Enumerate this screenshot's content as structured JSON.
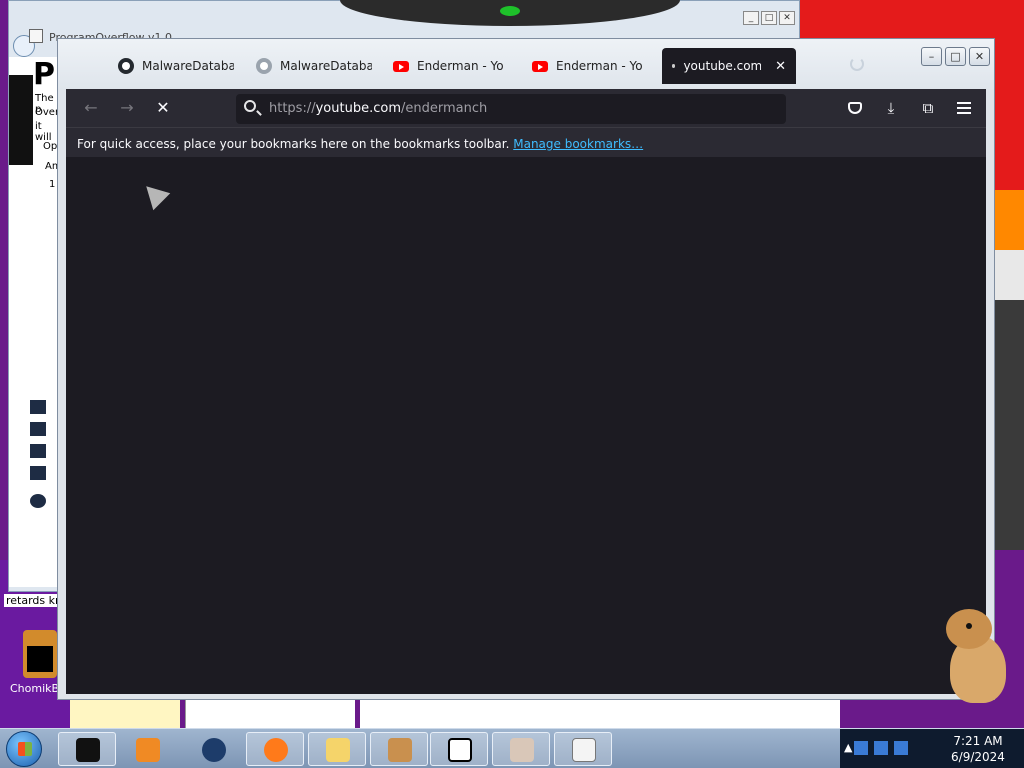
{
  "background_window": {
    "title": "ProgramOverflow v1.0",
    "heading_initial": "Pr",
    "text_lines": [
      "The p",
      "Over",
      "it will"
    ],
    "group_label": "Op",
    "field_label": "Am",
    "field_value": "1"
  },
  "desktop": {
    "text_strip": "retards kn",
    "icon_label": "ChomikB"
  },
  "browser": {
    "tabs": [
      {
        "label": "MalwareDatabase",
        "icon": "github-icon"
      },
      {
        "label": "MalwareDatabase",
        "icon": "github-icon"
      },
      {
        "label": "Enderman - YouTube",
        "icon": "youtube-icon"
      },
      {
        "label": "Enderman - YouTube",
        "icon": "youtube-icon"
      },
      {
        "label": "youtube.com/e",
        "icon": "loading-dot-icon",
        "active": true
      }
    ],
    "url": {
      "protocol": "https://",
      "host": "youtube.com",
      "path": "/endermanch"
    },
    "bookmarks_bar": {
      "message": "For quick access, place your bookmarks here on the bookmarks toolbar.",
      "link": "Manage bookmarks…"
    },
    "toolbar_icons": [
      "back-icon",
      "forward-icon",
      "stop-icon",
      "pocket-icon",
      "download-icon",
      "extensions-icon",
      "menu-icon"
    ]
  },
  "taskbar": {
    "apps": [
      "start-orb",
      "black-window-app",
      "media-app",
      "earth-app",
      "firefox-app",
      "explorer-app",
      "hamster-app",
      "7zip-app",
      "cat-app",
      "paint-app"
    ],
    "time": "7:21 AM",
    "date": "6/9/2024"
  },
  "colors": {
    "content_bg": "#1c1b22",
    "toolbar_bg": "#2b2a33",
    "link": "#3fbdff"
  }
}
